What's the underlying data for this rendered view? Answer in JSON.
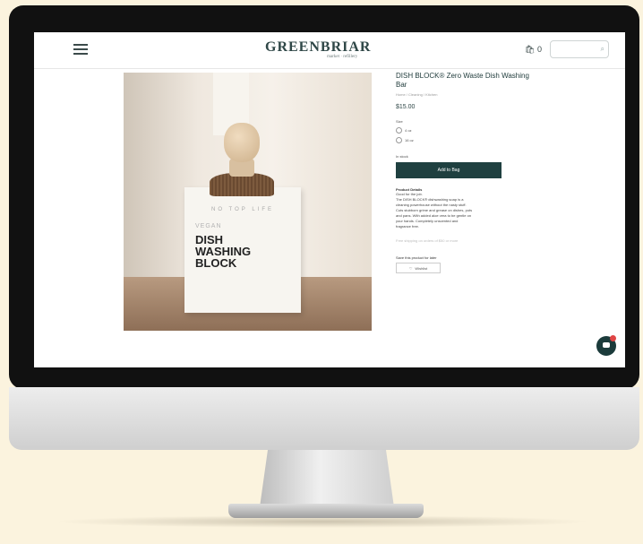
{
  "header": {
    "brand": "GREENBRIAR",
    "brand_sub": "market · refillery",
    "cart_label": "0"
  },
  "search": {
    "placeholder": ""
  },
  "product_image": {
    "ribbon_text": "NO TOP LIFE",
    "vegan_label": "VEGAN",
    "box_title_1": "DISH",
    "box_title_2": "WASHING",
    "box_title_3": "BLOCK"
  },
  "product": {
    "title": "DISH BLOCK® Zero Waste Dish Washing Bar",
    "breadcrumbs": "Home / Cleaning / Kitchen",
    "price": "$15.00",
    "size_label": "Size",
    "options": [
      "4 oz",
      "16 oz"
    ],
    "stock": "In stock",
    "add_to_bag": "Add to Bag",
    "details_heading": "Product Details",
    "details": [
      "Good for the job.",
      "The DISH BLOCK® dishwashing soap is a",
      "cleaning powerhouse without the nasty stuff.",
      "Cuts stubborn grime and grease on dishes, pots",
      "and pans. With added aloe vera to be gentle on",
      "your hands. Completely unscented and",
      "fragrance free."
    ],
    "faded_line": "Free shipping on orders of $50 or more",
    "save_heading": "Save this product for later",
    "wishlist_label": "Wishlist"
  },
  "chat": {
    "badge": ""
  }
}
